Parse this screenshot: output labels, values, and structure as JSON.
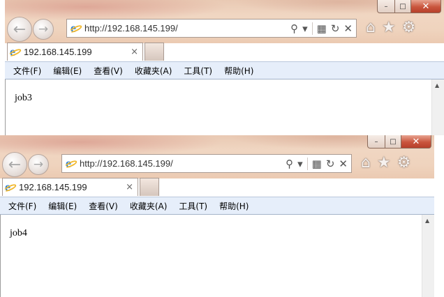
{
  "windows": [
    {
      "url": "http://192.168.145.199/",
      "tab_title": "192.168.145.199",
      "tab_close": "×",
      "menu": [
        "文件(F)",
        "编辑(E)",
        "查看(V)",
        "收藏夹(A)",
        "工具(T)",
        "帮助(H)"
      ],
      "content_text": "job3"
    },
    {
      "url": "http://192.168.145.199/",
      "tab_title": "192.168.145.199",
      "tab_close": "×",
      "menu": [
        "文件(F)",
        "编辑(E)",
        "查看(V)",
        "收藏夹(A)",
        "工具(T)",
        "帮助(H)"
      ],
      "content_text": "job4"
    }
  ],
  "glyphs": {
    "back": "←",
    "forward": "→",
    "search": "⚲",
    "dropdown": "▾",
    "compat": "▦",
    "refresh": "↻",
    "stop": "✕",
    "home": "⌂",
    "favorites": "★",
    "settings": "⚙",
    "minimize": "–",
    "maximize": "□",
    "close": "✕",
    "scroll_up": "▲"
  },
  "icons": [
    "ie-logo-icon",
    "back-arrow-icon",
    "forward-arrow-icon",
    "search-icon",
    "dropdown-icon",
    "compatibility-view-icon",
    "refresh-icon",
    "stop-icon",
    "home-icon",
    "favorites-star-icon",
    "settings-gear-icon"
  ],
  "colors": {
    "ie_blue": "#2d7fd3",
    "ie_gold": "#f1b82d",
    "close_red": "#c9553d",
    "menubar": "#e6eefa"
  }
}
